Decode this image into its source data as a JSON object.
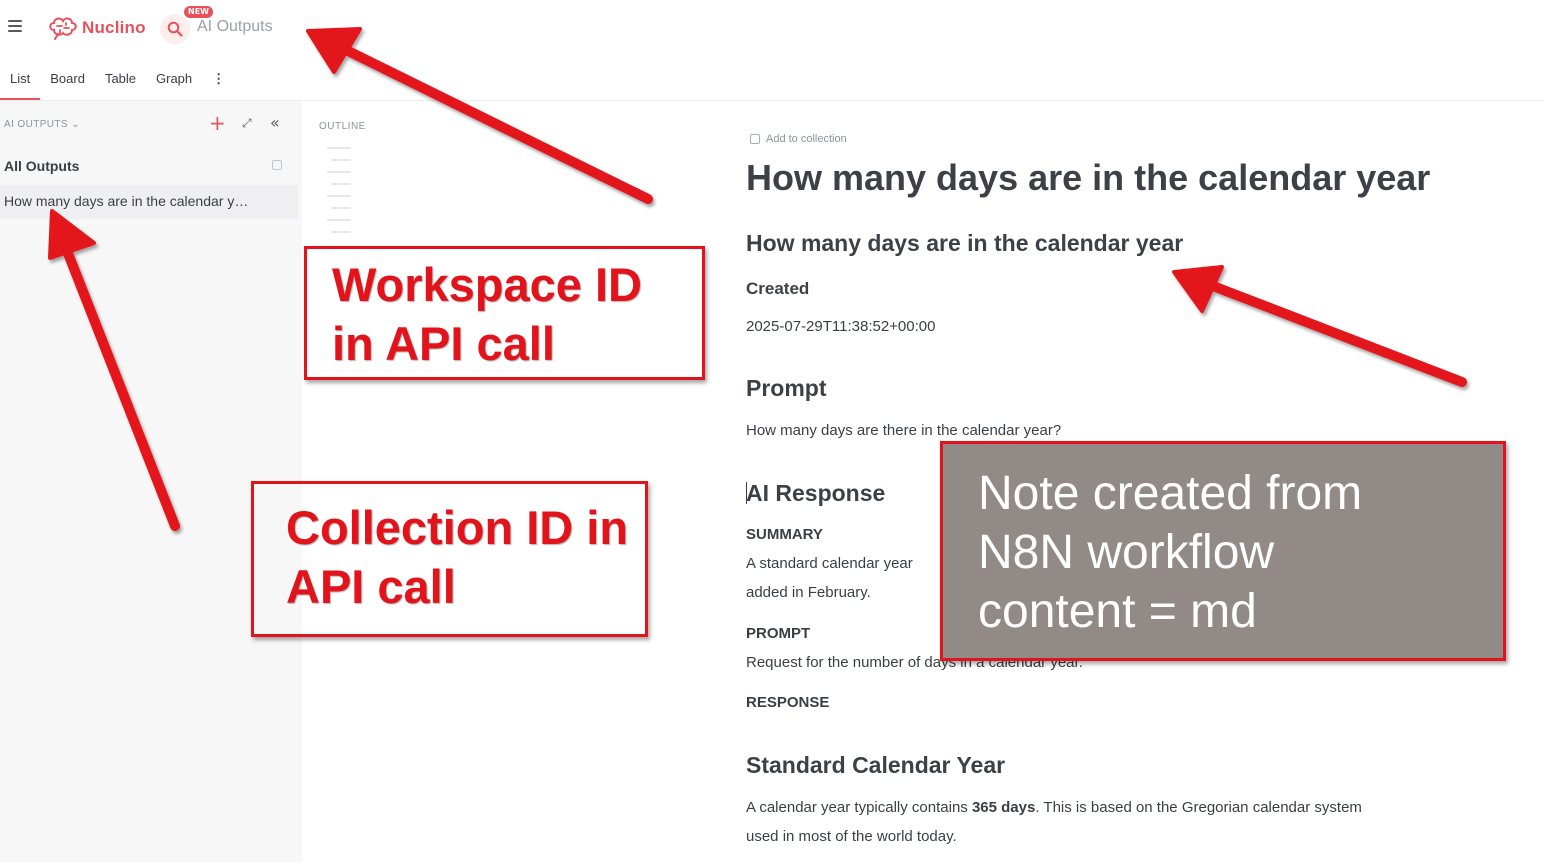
{
  "header": {
    "app_name": "Nuclino",
    "new_badge": "NEW",
    "workspace_name": "AI Outputs",
    "icons": [
      "menu-icon",
      "nuclino-brain-logo",
      "search-icon"
    ]
  },
  "tabs": [
    {
      "label": "List",
      "active": true
    },
    {
      "label": "Board",
      "active": false
    },
    {
      "label": "Table",
      "active": false
    },
    {
      "label": "Graph",
      "active": false
    },
    {
      "label": "⋮",
      "active": false
    }
  ],
  "sidebar": {
    "section_label": "AI OUTPUTS",
    "all_label": "All Outputs",
    "items": [
      {
        "label": "How many days are in the calendar y…"
      }
    ],
    "icons": [
      "chevron-down-icon",
      "plus-icon",
      "expand-icon",
      "collapse-icon",
      "copy-icon"
    ]
  },
  "outline": {
    "label": "OUTLINE"
  },
  "document": {
    "add_collection": "Add to collection",
    "title": "How many days are in the calendar year",
    "heading_main": "How many days are in the calendar year",
    "created_label": "Created",
    "created_value": "2025-07-29T11:38:52+00:00",
    "prompt_heading": "Prompt",
    "prompt_text": "How many days are there in the calendar year?",
    "ai_response_heading": "AI Response",
    "summary_label": "SUMMARY",
    "summary_text_1": "A standard calendar year",
    "summary_text_2": "added in February.",
    "prompt_label": "PROMPT",
    "prompt_summary": "Request for the number of days in a calendar year.",
    "response_label": "RESPONSE",
    "section_heading": "Standard Calendar Year",
    "body_1_pre": "A calendar year typically contains ",
    "body_1_bold": "365 days",
    "body_1_post": ". This is based on the Gregorian calendar system",
    "body_2": "used in most of the world today."
  },
  "annotations": {
    "workspace_line1": "Workspace ID",
    "workspace_line2": "in API call",
    "collection_line1": "Collection ID in",
    "collection_line2": "API call",
    "note_line1": "Note created from",
    "note_line2": "N8N workflow",
    "note_line3": "content = md",
    "annotation_color": "#e3131b",
    "note_box_color": "#918a86"
  },
  "colors": {
    "brand": "#e8505b",
    "sidebar_bg": "#f7f7f8",
    "text": "#3b3f45"
  }
}
